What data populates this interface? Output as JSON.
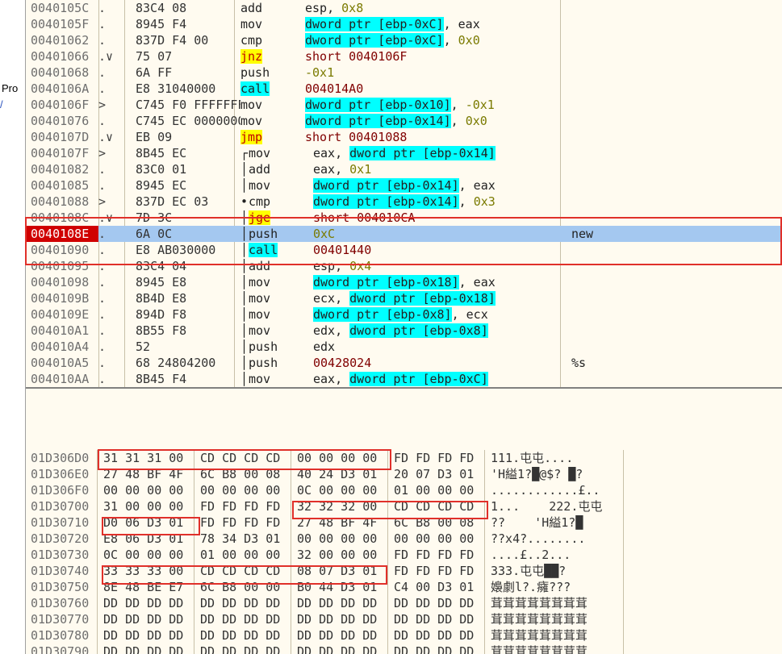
{
  "left_strip": {
    "frag1": "Pro",
    "frag2": "/"
  },
  "disasm": [
    {
      "addr": "0040105C",
      "sep": ".",
      "hex": "83C4 08",
      "mn": "add",
      "op": [
        [
          "",
          "esp, "
        ],
        [
          "num",
          "0x8"
        ]
      ],
      "cm": ""
    },
    {
      "addr": "0040105F",
      "sep": ".",
      "hex": "8945 F4",
      "mn": "mov",
      "op": [
        [
          "cyan",
          "dword ptr [ebp-0xC]"
        ],
        [
          "",
          ", eax"
        ]
      ],
      "cm": ""
    },
    {
      "addr": "00401062",
      "sep": ".",
      "hex": "837D F4 00",
      "mn": "cmp",
      "op": [
        [
          "cyan",
          "dword ptr [ebp-0xC]"
        ],
        [
          "",
          ", "
        ],
        [
          "num",
          "0x0"
        ]
      ],
      "cm": ""
    },
    {
      "addr": "00401066",
      "sep": ".∨",
      "hex": "75 07",
      "mn": "jnz",
      "mnhl": "yellow",
      "op": [
        [
          "tgt",
          "short 0040106F"
        ]
      ],
      "cm": ""
    },
    {
      "addr": "00401068",
      "sep": ".",
      "hex": "6A FF",
      "mn": "push",
      "op": [
        [
          "num",
          "-0x1"
        ]
      ],
      "cm": ""
    },
    {
      "addr": "0040106A",
      "sep": ".",
      "hex": "E8 31040000",
      "mn": "call",
      "mnhl": "cyan",
      "op": [
        [
          "tgt",
          "004014A0"
        ]
      ],
      "cm": ""
    },
    {
      "addr": "0040106F",
      "sep": ">",
      "hex": "C745 F0 FFFFFFFF",
      "mn": "mov",
      "op": [
        [
          "cyan",
          "dword ptr [ebp-0x10]"
        ],
        [
          "",
          ", "
        ],
        [
          "num",
          "-0x1"
        ]
      ],
      "cm": ""
    },
    {
      "addr": "00401076",
      "sep": ".",
      "hex": "C745 EC 00000000",
      "mn": "mov",
      "op": [
        [
          "cyan",
          "dword ptr [ebp-0x14]"
        ],
        [
          "",
          ", "
        ],
        [
          "num",
          "0x0"
        ]
      ],
      "cm": ""
    },
    {
      "addr": "0040107D",
      "sep": ".∨",
      "hex": "EB 09",
      "mn": "jmp",
      "mnhl": "yellow",
      "op": [
        [
          "tgt",
          "short 00401088"
        ]
      ],
      "cm": ""
    },
    {
      "addr": "0040107F",
      "sep": ">",
      "hex": "8B45 EC",
      "mn": "mov",
      "op": [
        [
          "",
          "eax, "
        ],
        [
          "cyan",
          "dword ptr [ebp-0x14]"
        ]
      ],
      "cm": "",
      "ind": 1
    },
    {
      "addr": "00401082",
      "sep": ".",
      "hex": "83C0 01",
      "mn": "add",
      "op": [
        [
          "",
          "eax, "
        ],
        [
          "num",
          "0x1"
        ]
      ],
      "cm": "",
      "ind": 1
    },
    {
      "addr": "00401085",
      "sep": ".",
      "hex": "8945 EC",
      "mn": "mov",
      "op": [
        [
          "cyan",
          "dword ptr [ebp-0x14]"
        ],
        [
          "",
          ", eax"
        ]
      ],
      "cm": "",
      "ind": 1
    },
    {
      "addr": "00401088",
      "sep": ">",
      "hex": "837D EC 03",
      "mn": "cmp",
      "op": [
        [
          "cyan",
          "dword ptr [ebp-0x14]"
        ],
        [
          "",
          ", "
        ],
        [
          "num",
          "0x3"
        ]
      ],
      "cm": "",
      "ind": 1
    },
    {
      "addr": "0040108C",
      "sep": ".∨",
      "hex": "7D 3C",
      "mn": "jge",
      "mnhl": "yellow",
      "op": [
        [
          "tgt",
          "short 004010CA"
        ]
      ],
      "cm": "",
      "ind": 1
    },
    {
      "addr": "0040108E",
      "sep": ".",
      "hex": "6A 0C",
      "mn": "push",
      "op": [
        [
          "num",
          "0xC"
        ]
      ],
      "cm": "new",
      "ind": 1,
      "sel": true,
      "addrhl": true
    },
    {
      "addr": "00401090",
      "sep": ".",
      "hex": "E8 AB030000",
      "mn": "call",
      "mnhl": "cyan",
      "op": [
        [
          "tgt",
          "00401440"
        ]
      ],
      "cm": "",
      "ind": 1
    },
    {
      "addr": "00401095",
      "sep": ".",
      "hex": "83C4 04",
      "mn": "add",
      "op": [
        [
          "",
          "esp, "
        ],
        [
          "num",
          "0x4"
        ]
      ],
      "cm": "",
      "ind": 1
    },
    {
      "addr": "00401098",
      "sep": ".",
      "hex": "8945 E8",
      "mn": "mov",
      "op": [
        [
          "cyan",
          "dword ptr [ebp-0x18]"
        ],
        [
          "",
          ", eax"
        ]
      ],
      "cm": "",
      "ind": 1
    },
    {
      "addr": "0040109B",
      "sep": ".",
      "hex": "8B4D E8",
      "mn": "mov",
      "op": [
        [
          "",
          "ecx, "
        ],
        [
          "cyan",
          "dword ptr [ebp-0x18]"
        ]
      ],
      "cm": "",
      "ind": 1
    },
    {
      "addr": "0040109E",
      "sep": ".",
      "hex": "894D F8",
      "mn": "mov",
      "op": [
        [
          "cyan",
          "dword ptr [ebp-0x8]"
        ],
        [
          "",
          ", ecx"
        ]
      ],
      "cm": "",
      "ind": 1
    },
    {
      "addr": "004010A1",
      "sep": ".",
      "hex": "8B55 F8",
      "mn": "mov",
      "op": [
        [
          "",
          "edx, "
        ],
        [
          "cyan",
          "dword ptr [ebp-0x8]"
        ]
      ],
      "cm": "",
      "ind": 1
    },
    {
      "addr": "004010A4",
      "sep": ".",
      "hex": "52",
      "mn": "push",
      "op": [
        [
          "",
          "edx"
        ]
      ],
      "cm": "",
      "ind": 1
    },
    {
      "addr": "004010A5",
      "sep": ".",
      "hex": "68 24804200",
      "mn": "push",
      "op": [
        [
          "tgt",
          "00428024"
        ]
      ],
      "cm": "%s",
      "ind": 1
    },
    {
      "addr": "004010AA",
      "sep": ".",
      "hex": "8B45 F4",
      "mn": "mov",
      "op": [
        [
          "",
          "eax, "
        ],
        [
          "cyan",
          "dword ptr [ebp-0xC]"
        ]
      ],
      "cm": "",
      "ind": 1
    }
  ],
  "dump": [
    {
      "addr": "01D306D0",
      "g": [
        "31 31 31 00",
        "CD CD CD CD",
        "00 00 00 00",
        "FD FD FD FD"
      ],
      "asc": "111.屯屯...."
    },
    {
      "addr": "01D306E0",
      "g": [
        "27 48 BF 4F",
        "6C B8 00 08",
        "40 24 D3 01",
        "20 07 D3 01"
      ],
      "asc": "'H縊1?█@$? █?"
    },
    {
      "addr": "01D306F0",
      "g": [
        "00 00 00 00",
        "00 00 00 00",
        "0C 00 00 00",
        "01 00 00 00"
      ],
      "asc": "............£.."
    },
    {
      "addr": "01D30700",
      "g": [
        "31 00 00 00",
        "FD FD FD FD",
        "32 32 32 00",
        "CD CD CD CD"
      ],
      "asc": "1...    222.屯屯"
    },
    {
      "addr": "01D30710",
      "g": [
        "D0 06 D3 01",
        "FD FD FD FD",
        "27 48 BF 4F",
        "6C B8 00 08"
      ],
      "asc": "??    'H縊1?█"
    },
    {
      "addr": "01D30720",
      "g": [
        "E8 06 D3 01",
        "78 34 D3 01",
        "00 00 00 00",
        "00 00 00 00"
      ],
      "asc": "??x4?........"
    },
    {
      "addr": "01D30730",
      "g": [
        "0C 00 00 00",
        "01 00 00 00",
        "32 00 00 00",
        "FD FD FD FD"
      ],
      "asc": "....£..2..."
    },
    {
      "addr": "01D30740",
      "g": [
        "33 33 33 00",
        "CD CD CD CD",
        "08 07 D3 01",
        "FD FD FD FD"
      ],
      "asc": "333.屯屯██?"
    },
    {
      "addr": "01D30750",
      "g": [
        "8E 48 BE E7",
        "6C B8 00 00",
        "B0 44 D3 01",
        "C4 00 D3 01"
      ],
      "asc": "嬝劇l?.癕???"
    },
    {
      "addr": "01D30760",
      "g": [
        "DD DD DD DD",
        "DD DD DD DD",
        "DD DD DD DD",
        "DD DD DD DD"
      ],
      "asc": "茸茸茸茸茸茸茸茸"
    },
    {
      "addr": "01D30770",
      "g": [
        "DD DD DD DD",
        "DD DD DD DD",
        "DD DD DD DD",
        "DD DD DD DD"
      ],
      "asc": "茸茸茸茸茸茸茸茸"
    },
    {
      "addr": "01D30780",
      "g": [
        "DD DD DD DD",
        "DD DD DD DD",
        "DD DD DD DD",
        "DD DD DD DD"
      ],
      "asc": "茸茸茸茸茸茸茸茸"
    },
    {
      "addr": "01D30790",
      "g": [
        "DD DD DD DD",
        "DD DD DD DD",
        "DD DD DD DD",
        "DD DD DD DD"
      ],
      "asc": "茸茸茸茸茸茸茸茸"
    }
  ],
  "colors": {
    "bg": "#fffbf0",
    "cyan_highlight": "#00ffff",
    "yellow_highlight": "#ffff00",
    "selection": "#a4c8f0",
    "annotation_box": "#e0302a",
    "address_highlight": "#d00000"
  }
}
